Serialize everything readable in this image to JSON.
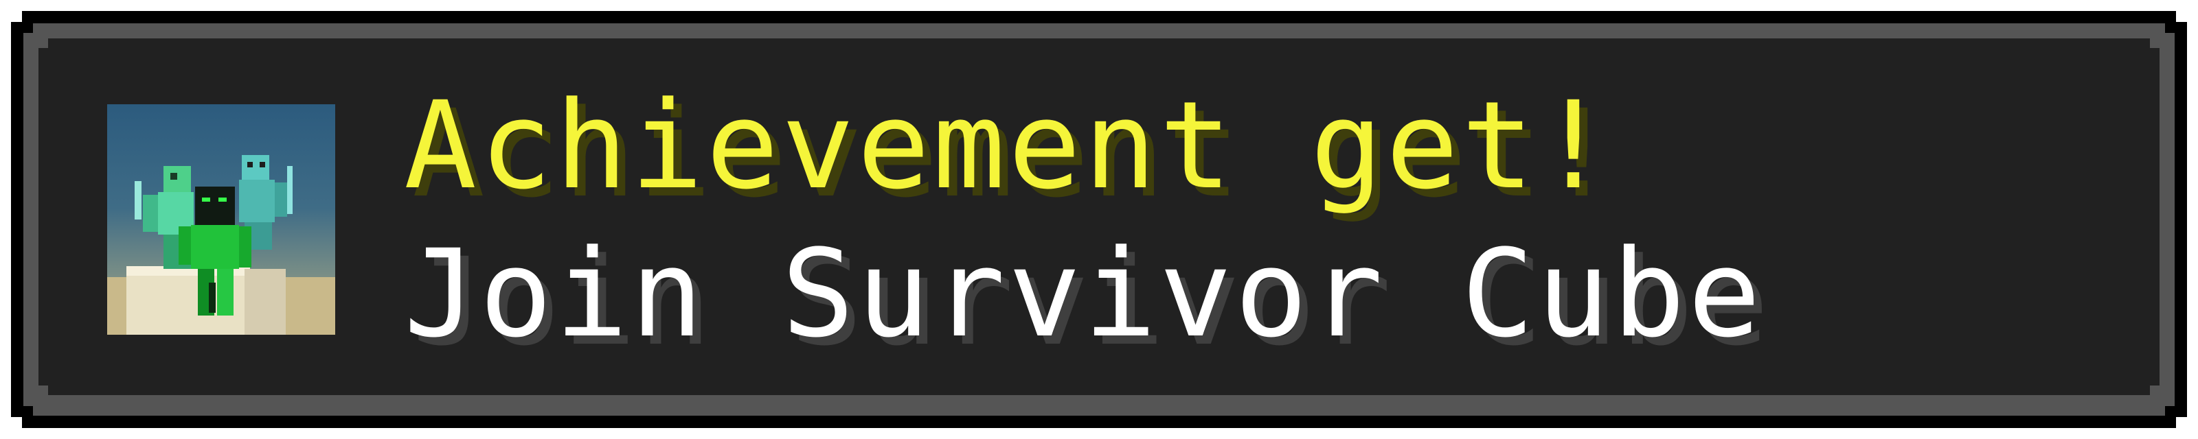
{
  "toast": {
    "title": "Achievement get!",
    "description": "Join Survivor Cube",
    "icon": "survivor-cube-server-icon"
  },
  "colors": {
    "title": "#f5f53a",
    "description": "#ffffff",
    "panel": "#212121",
    "border": "#555555"
  }
}
